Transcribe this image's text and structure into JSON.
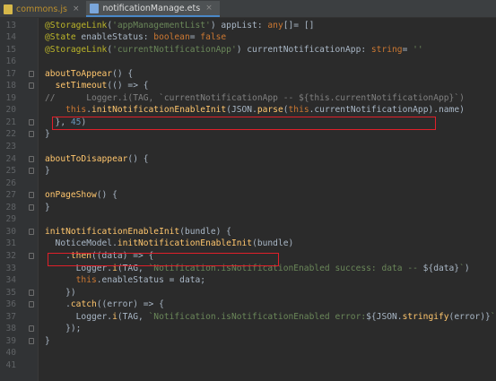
{
  "tabs": [
    {
      "label": "commons.js",
      "active": false
    },
    {
      "label": "notificationManage.ets",
      "active": true
    }
  ],
  "colors": {
    "background": "#2b2b2b",
    "highlight_box": "#e0202a",
    "keyword": "#cc7832",
    "string": "#6a8759",
    "annotation": "#bbb529",
    "function": "#ffc66d",
    "comment": "#808080"
  },
  "lines": [
    {
      "n": "13",
      "fold": false,
      "tokens": [
        [
          "ann",
          "@StorageLink"
        ],
        [
          "id",
          "("
        ],
        [
          "str",
          "'appManagementList'"
        ],
        [
          "id",
          ") appList: "
        ],
        [
          "kw",
          "any"
        ],
        [
          "id",
          "[]= []"
        ]
      ]
    },
    {
      "n": "14",
      "fold": false,
      "tokens": [
        [
          "ann",
          "@State"
        ],
        [
          "id",
          " enableStatus: "
        ],
        [
          "kw",
          "boolean"
        ],
        [
          "id",
          "= "
        ],
        [
          "kw",
          "false"
        ]
      ]
    },
    {
      "n": "15",
      "fold": false,
      "tokens": [
        [
          "ann",
          "@StorageLink"
        ],
        [
          "id",
          "("
        ],
        [
          "str",
          "'currentNotificationApp'"
        ],
        [
          "id",
          ") currentNotificationApp: "
        ],
        [
          "kw",
          "string"
        ],
        [
          "id",
          "= "
        ],
        [
          "str",
          "''"
        ]
      ]
    },
    {
      "n": "16",
      "fold": false,
      "tokens": []
    },
    {
      "n": "17",
      "fold": true,
      "tokens": [
        [
          "fn",
          "aboutToAppear"
        ],
        [
          "id",
          "() {"
        ]
      ]
    },
    {
      "n": "18",
      "fold": true,
      "tokens": [
        [
          "id",
          "  "
        ],
        [
          "fn",
          "setTimeout"
        ],
        [
          "id",
          "(() => {"
        ]
      ]
    },
    {
      "n": "19",
      "fold": false,
      "tokens": [
        [
          "cm",
          "//      Logger.i(TAG, `currentNotificationApp -- ${this.currentNotificationApp}`)"
        ]
      ]
    },
    {
      "n": "20",
      "fold": false,
      "tokens": [
        [
          "id",
          "    "
        ],
        [
          "kw",
          "this"
        ],
        [
          "id",
          "."
        ],
        [
          "fn",
          "initNotificationEnableInit"
        ],
        [
          "id",
          "(JSON."
        ],
        [
          "fn",
          "parse"
        ],
        [
          "id",
          "("
        ],
        [
          "kw",
          "this"
        ],
        [
          "id",
          ".currentNotificationApp).name)"
        ]
      ]
    },
    {
      "n": "21",
      "fold": true,
      "tokens": [
        [
          "id",
          "  }, "
        ],
        [
          "num",
          "45"
        ],
        [
          "id",
          ")"
        ]
      ]
    },
    {
      "n": "22",
      "fold": true,
      "tokens": [
        [
          "id",
          "}"
        ]
      ]
    },
    {
      "n": "23",
      "fold": false,
      "tokens": []
    },
    {
      "n": "24",
      "fold": true,
      "tokens": [
        [
          "fn",
          "aboutToDisappear"
        ],
        [
          "id",
          "() {"
        ]
      ]
    },
    {
      "n": "25",
      "fold": true,
      "tokens": [
        [
          "id",
          "}"
        ]
      ]
    },
    {
      "n": "26",
      "fold": false,
      "tokens": []
    },
    {
      "n": "27",
      "fold": true,
      "tokens": [
        [
          "fn",
          "onPageShow"
        ],
        [
          "id",
          "() {"
        ]
      ]
    },
    {
      "n": "28",
      "fold": true,
      "tokens": [
        [
          "id",
          "}"
        ]
      ]
    },
    {
      "n": "29",
      "fold": false,
      "tokens": []
    },
    {
      "n": "30",
      "fold": true,
      "tokens": [
        [
          "fn",
          "initNotificationEnableInit"
        ],
        [
          "id",
          "(bundle) {"
        ]
      ]
    },
    {
      "n": "31",
      "fold": false,
      "tokens": [
        [
          "id",
          "  NoticeModel."
        ],
        [
          "fn",
          "initNotificationEnableInit"
        ],
        [
          "id",
          "(bundle)"
        ]
      ]
    },
    {
      "n": "32",
      "fold": true,
      "tokens": [
        [
          "id",
          "    ."
        ],
        [
          "fn",
          "then"
        ],
        [
          "id",
          "((data) => {"
        ]
      ]
    },
    {
      "n": "33",
      "fold": false,
      "tokens": [
        [
          "id",
          "      Logger."
        ],
        [
          "fn",
          "i"
        ],
        [
          "id",
          "(TAG, "
        ],
        [
          "str",
          "`Notification.isNotificationEnabled success: data -- "
        ],
        [
          "id",
          "${data}"
        ],
        [
          "str",
          "`"
        ],
        [
          "id",
          ")"
        ]
      ]
    },
    {
      "n": "34",
      "fold": false,
      "tokens": [
        [
          "id",
          "      "
        ],
        [
          "kw",
          "this"
        ],
        [
          "id",
          ".enableStatus = data;"
        ]
      ]
    },
    {
      "n": "35",
      "fold": true,
      "tokens": [
        [
          "id",
          "    })"
        ]
      ]
    },
    {
      "n": "36",
      "fold": true,
      "tokens": [
        [
          "id",
          "    ."
        ],
        [
          "fn",
          "catch"
        ],
        [
          "id",
          "((error) => {"
        ]
      ]
    },
    {
      "n": "37",
      "fold": false,
      "tokens": [
        [
          "id",
          "      Logger."
        ],
        [
          "fn",
          "i"
        ],
        [
          "id",
          "(TAG, "
        ],
        [
          "str",
          "`Notification.isNotificationEnabled error:"
        ],
        [
          "id",
          "${JSON."
        ],
        [
          "fn",
          "stringify"
        ],
        [
          "id",
          "(error)}"
        ],
        [
          "str",
          "`"
        ],
        [
          "id",
          ")"
        ]
      ]
    },
    {
      "n": "38",
      "fold": true,
      "tokens": [
        [
          "id",
          "    });"
        ]
      ]
    },
    {
      "n": "39",
      "fold": true,
      "tokens": [
        [
          "id",
          "}"
        ]
      ]
    },
    {
      "n": "40",
      "fold": false,
      "tokens": []
    },
    {
      "n": "41",
      "fold": false,
      "tokens": []
    }
  ],
  "highlight_lines": [
    "20",
    "31"
  ]
}
